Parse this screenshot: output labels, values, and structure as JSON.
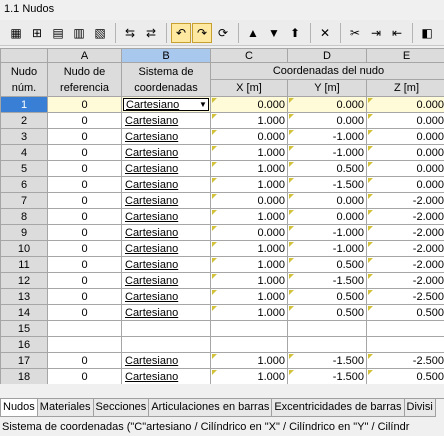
{
  "window": {
    "title": "1.1 Nudos"
  },
  "toolbar": {
    "buttons": [
      {
        "icon": "▦",
        "name": "excel-export-icon"
      },
      {
        "icon": "⊞",
        "name": "insert-row-icon"
      },
      {
        "icon": "▤",
        "name": "table-icon"
      },
      {
        "icon": "▥",
        "name": "filter-icon"
      },
      {
        "icon": "▧",
        "name": "grid-icon"
      },
      {
        "sep": true
      },
      {
        "icon": "⇆",
        "name": "export-icon"
      },
      {
        "icon": "⇄",
        "name": "import-icon"
      },
      {
        "sep": true
      },
      {
        "icon": "↶",
        "name": "undo-icon",
        "active": true
      },
      {
        "icon": "↷",
        "name": "redo-icon",
        "active": true
      },
      {
        "icon": "⟳",
        "name": "refresh-icon"
      },
      {
        "sep": true
      },
      {
        "icon": "▲",
        "name": "move-up-icon"
      },
      {
        "icon": "▼",
        "name": "move-down-icon"
      },
      {
        "icon": "⬆",
        "name": "sort-icon"
      },
      {
        "sep": true
      },
      {
        "icon": "✕",
        "name": "delete-icon"
      },
      {
        "sep": true
      },
      {
        "icon": "✂",
        "name": "cut-row-icon"
      },
      {
        "icon": "⇥",
        "name": "insert-col-icon"
      },
      {
        "icon": "⇤",
        "name": "remove-col-icon"
      },
      {
        "sep": true
      },
      {
        "icon": "◧",
        "name": "view-icon"
      }
    ]
  },
  "grid": {
    "letters": [
      "A",
      "B",
      "C",
      "D",
      "E"
    ],
    "headers": {
      "row_label": "Nudo núm.",
      "ref": "Nudo de referencia",
      "sys": "Sistema de coordenadas",
      "coords_group": "Coordenadas del nudo",
      "x": "X [m]",
      "y": "Y [m]",
      "z": "Z [m]"
    },
    "rows": [
      {
        "n": "1",
        "ref": "0",
        "sys": "Cartesiano",
        "x": "0.000",
        "y": "0.000",
        "z": "0.000"
      },
      {
        "n": "2",
        "ref": "0",
        "sys": "Cartesiano",
        "x": "1.000",
        "y": "0.000",
        "z": "0.000"
      },
      {
        "n": "3",
        "ref": "0",
        "sys": "Cartesiano",
        "x": "0.000",
        "y": "-1.000",
        "z": "0.000"
      },
      {
        "n": "4",
        "ref": "0",
        "sys": "Cartesiano",
        "x": "1.000",
        "y": "-1.000",
        "z": "0.000"
      },
      {
        "n": "5",
        "ref": "0",
        "sys": "Cartesiano",
        "x": "1.000",
        "y": "0.500",
        "z": "0.000"
      },
      {
        "n": "6",
        "ref": "0",
        "sys": "Cartesiano",
        "x": "1.000",
        "y": "-1.500",
        "z": "0.000"
      },
      {
        "n": "7",
        "ref": "0",
        "sys": "Cartesiano",
        "x": "0.000",
        "y": "0.000",
        "z": "-2.000"
      },
      {
        "n": "8",
        "ref": "0",
        "sys": "Cartesiano",
        "x": "1.000",
        "y": "0.000",
        "z": "-2.000"
      },
      {
        "n": "9",
        "ref": "0",
        "sys": "Cartesiano",
        "x": "0.000",
        "y": "-1.000",
        "z": "-2.000"
      },
      {
        "n": "10",
        "ref": "0",
        "sys": "Cartesiano",
        "x": "1.000",
        "y": "-1.000",
        "z": "-2.000"
      },
      {
        "n": "11",
        "ref": "0",
        "sys": "Cartesiano",
        "x": "1.000",
        "y": "0.500",
        "z": "-2.000"
      },
      {
        "n": "12",
        "ref": "0",
        "sys": "Cartesiano",
        "x": "1.000",
        "y": "-1.500",
        "z": "-2.000"
      },
      {
        "n": "13",
        "ref": "0",
        "sys": "Cartesiano",
        "x": "1.000",
        "y": "0.500",
        "z": "-2.500"
      },
      {
        "n": "14",
        "ref": "0",
        "sys": "Cartesiano",
        "x": "1.000",
        "y": "0.500",
        "z": "0.500"
      },
      {
        "n": "15",
        "ref": "",
        "sys": "",
        "x": "",
        "y": "",
        "z": ""
      },
      {
        "n": "16",
        "ref": "",
        "sys": "",
        "x": "",
        "y": "",
        "z": ""
      },
      {
        "n": "17",
        "ref": "0",
        "sys": "Cartesiano",
        "x": "1.000",
        "y": "-1.500",
        "z": "-2.500"
      },
      {
        "n": "18",
        "ref": "0",
        "sys": "Cartesiano",
        "x": "1.000",
        "y": "-1.500",
        "z": "0.500"
      }
    ]
  },
  "tabs": [
    {
      "label": "Nudos",
      "active": true
    },
    {
      "label": "Materiales"
    },
    {
      "label": "Secciones"
    },
    {
      "label": "Articulaciones en barras"
    },
    {
      "label": "Excentricidades de barras"
    },
    {
      "label": "Divisi"
    }
  ],
  "status": {
    "text": "Sistema de coordenadas (\"C\"artesiano / Cilíndrico en \"X\" / Cilíndrico en \"Y\" / Cilíndr"
  },
  "colors": {
    "selection": "#3a7fd6",
    "header": "#dcdcdc",
    "active_row": "#fffbd8"
  }
}
